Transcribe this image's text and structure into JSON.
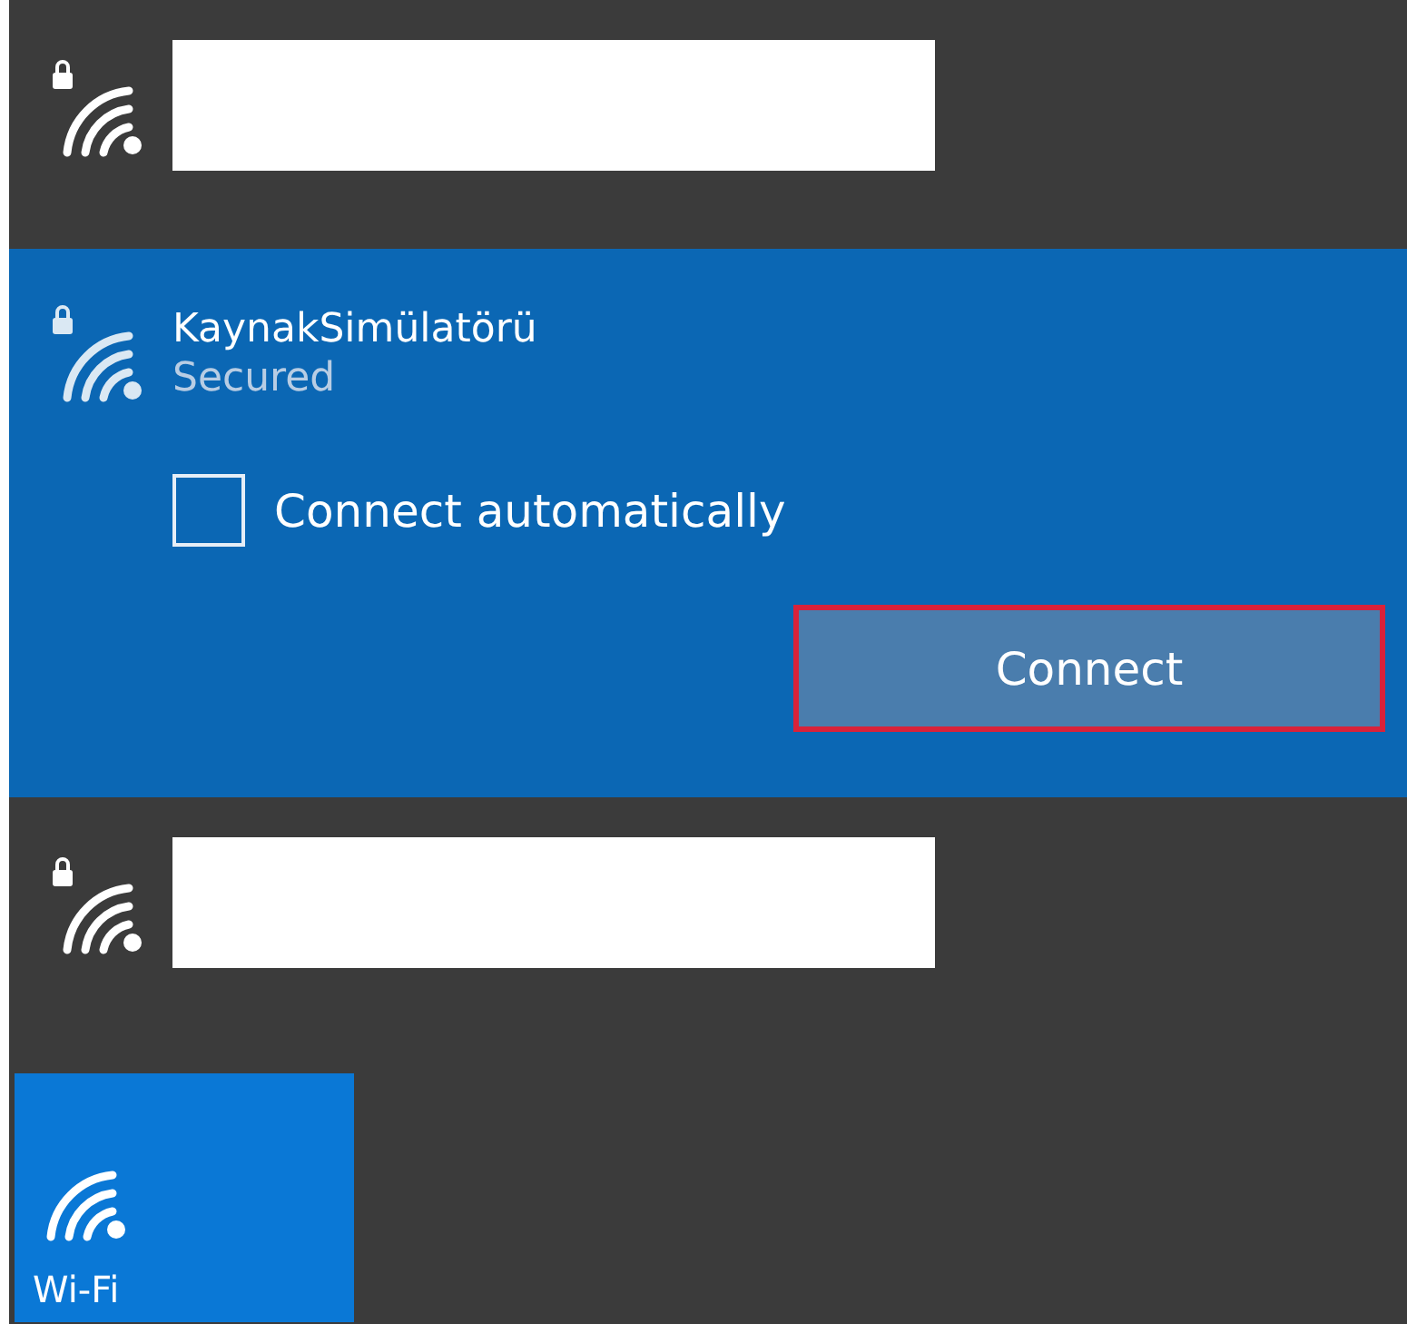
{
  "networks": [
    {
      "redacted": true,
      "selected": false,
      "secured": true
    },
    {
      "redacted": false,
      "selected": true,
      "secured": true,
      "name": "KaynakSimülatörü",
      "status": "Secured",
      "connect_automatically": {
        "label": "Connect automatically",
        "checked": false
      },
      "connect_button": {
        "label": "Connect",
        "highlighted": true
      }
    },
    {
      "redacted": true,
      "selected": false,
      "secured": true
    }
  ],
  "quick_actions": [
    {
      "label": "Wi-Fi",
      "on": true
    }
  ]
}
